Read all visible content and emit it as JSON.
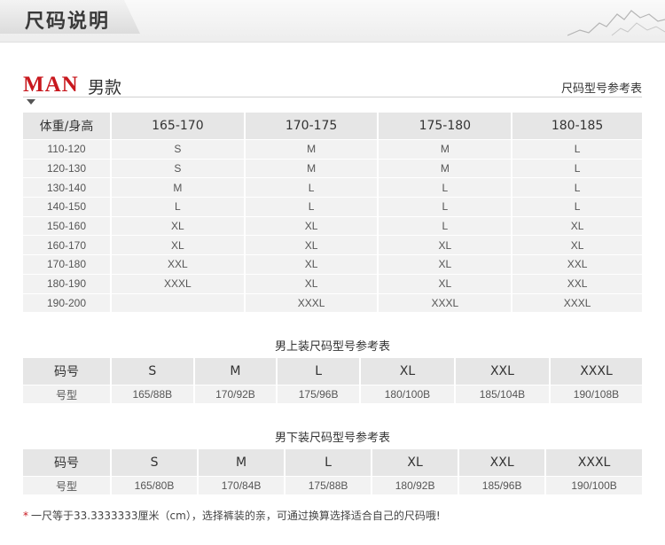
{
  "banner": {
    "title": "尺码说明"
  },
  "section": {
    "logo": "MAN",
    "title_cn": "男款",
    "ref_label": "尺码型号参考表"
  },
  "main_table": {
    "headers": [
      "体重/身高",
      "165-170",
      "170-175",
      "175-180",
      "180-185"
    ],
    "rows": [
      [
        "110-120",
        "S",
        "M",
        "M",
        "L"
      ],
      [
        "120-130",
        "S",
        "M",
        "M",
        "L"
      ],
      [
        "130-140",
        "M",
        "L",
        "L",
        "L"
      ],
      [
        "140-150",
        "L",
        "L",
        "L",
        "L"
      ],
      [
        "150-160",
        "XL",
        "XL",
        "L",
        "XL"
      ],
      [
        "160-170",
        "XL",
        "XL",
        "XL",
        "XL"
      ],
      [
        "170-180",
        "XXL",
        "XL",
        "XL",
        "XXL"
      ],
      [
        "180-190",
        "XXXL",
        "XL",
        "XL",
        "XXL"
      ],
      [
        "190-200",
        "",
        "XXXL",
        "XXXL",
        "XXXL"
      ]
    ]
  },
  "top_table": {
    "caption": "男上装尺码型号参考表",
    "headers": [
      "码号",
      "S",
      "M",
      "L",
      "XL",
      "XXL",
      "XXXL"
    ],
    "row": [
      "号型",
      "165/88B",
      "170/92B",
      "175/96B",
      "180/100B",
      "185/104B",
      "190/108B"
    ]
  },
  "bottom_table": {
    "caption": "男下装尺码型号参考表",
    "headers": [
      "码号",
      "S",
      "M",
      "L",
      "XL",
      "XXL",
      "XXXL"
    ],
    "row": [
      "号型",
      "165/80B",
      "170/84B",
      "175/88B",
      "180/92B",
      "185/96B",
      "190/100B"
    ]
  },
  "note": {
    "star": "*",
    "text": "一尺等于33.3333333厘米（cm），选择裤装的亲，可通过换算选择适合自己的尺码哦!"
  },
  "colors": {
    "accent": "#c8181e",
    "header_bg": "#e6e6e6",
    "cell_bg": "#f2f2f2"
  },
  "icons": {
    "banner_decoration": "mountain-icon",
    "section_marker": "arrow-down-icon"
  }
}
